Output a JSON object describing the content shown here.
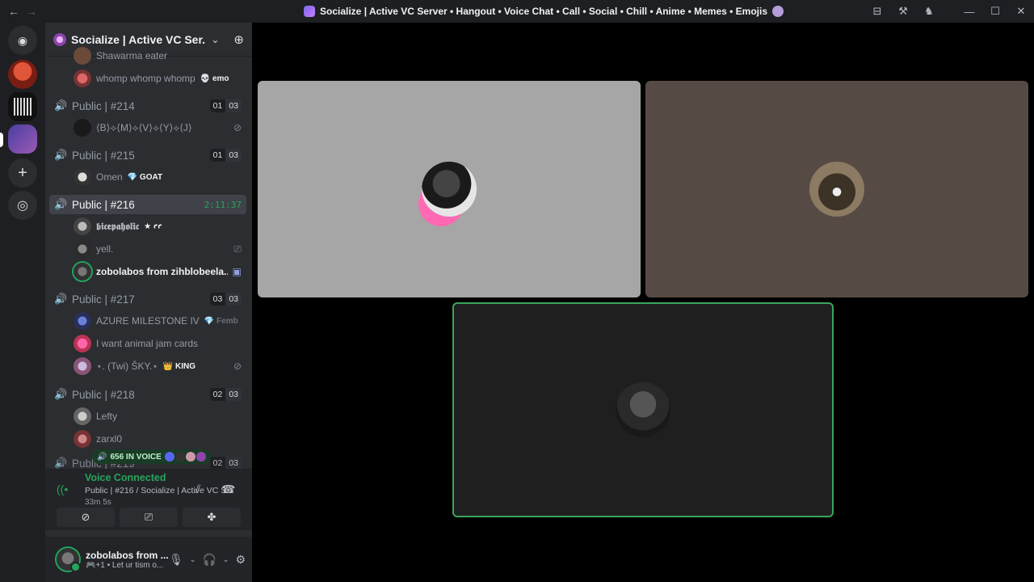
{
  "titlebar": {
    "back": "←",
    "forward": "→",
    "title": "Socialize | Active VC Server • Hangout • Voice Chat • Call • Social • Chill • Anime • Memes • Emojis",
    "inbox_icon": "⊟",
    "help_icon": "⚒",
    "apps_icon": "♞",
    "minimize": "—",
    "maximize": "☐",
    "close": "✕"
  },
  "rail": {
    "discord_icon": "◉",
    "add_icon": "+",
    "explore_icon": "◎"
  },
  "server": {
    "name": "Socialize | Active VC Ser...",
    "chevron": "⌄",
    "invite_icon": "⊕"
  },
  "channels": [
    {
      "name": "Public | #214",
      "count_a": "01",
      "count_b": "03"
    },
    {
      "name": "Public | #215",
      "count_a": "01",
      "count_b": "03"
    },
    {
      "name": "Public | #216",
      "timer": "2:11:37"
    },
    {
      "name": "Public | #217",
      "count_a": "03",
      "count_b": "03"
    },
    {
      "name": "Public | #218",
      "count_a": "02",
      "count_b": "03"
    },
    {
      "name": "Public | #219",
      "count_a": "02",
      "count_b": "03"
    }
  ],
  "users": [
    {
      "name": "Shawarma eater"
    },
    {
      "name": "whomp whomp whomp",
      "tag": "💀 emo"
    },
    {
      "name": "⟨B⟩⟡⟨M⟩⟡⟨V⟩⟡⟨Y⟩⟡⟨J⟩"
    },
    {
      "name": "Omen",
      "tag": "💎 GOAT"
    },
    {
      "name": "𝖇𝖎𝖈𝖊𝖕𝖆𝖍𝖔𝖑𝖎𝖈",
      "tag": "★ ꜥꜥ"
    },
    {
      "name": "yell."
    },
    {
      "name": "zobolabos from zihblobeela..."
    },
    {
      "name": "AZURE MILESTONE IV",
      "tag": "💎 Femb"
    },
    {
      "name": "I want animal jam cards"
    },
    {
      "name": "⋆. (Twi) ŠKY.⋆",
      "tag": "👑 KING"
    },
    {
      "name": "Lefty"
    },
    {
      "name": "zarxl0"
    }
  ],
  "voice_pill": {
    "text": "656 IN VOICE"
  },
  "voice_panel": {
    "title": "Voice Connected",
    "subtitle": "Public | #216 / Socialize | Active VC S...",
    "elapsed": "33m 5s",
    "signal_icon": "📶",
    "noise_icon": "⫽",
    "disconnect_icon": "☎"
  },
  "voice_buttons": {
    "camera": "⊘",
    "screen": "⎚",
    "activity": "✤"
  },
  "user_panel": {
    "name": "zobolabos from ...",
    "status": "🎮+1 • Let ur tism o...",
    "mic_icon": "🎙",
    "headset_icon": "🎧",
    "settings_icon": "⚙",
    "caret": "⌄"
  },
  "colors": {
    "accent_green": "#23a55a",
    "speaking_border": "#3ba55c",
    "sidebar_bg": "#2b2d31",
    "rail_bg": "#1e1f22"
  }
}
